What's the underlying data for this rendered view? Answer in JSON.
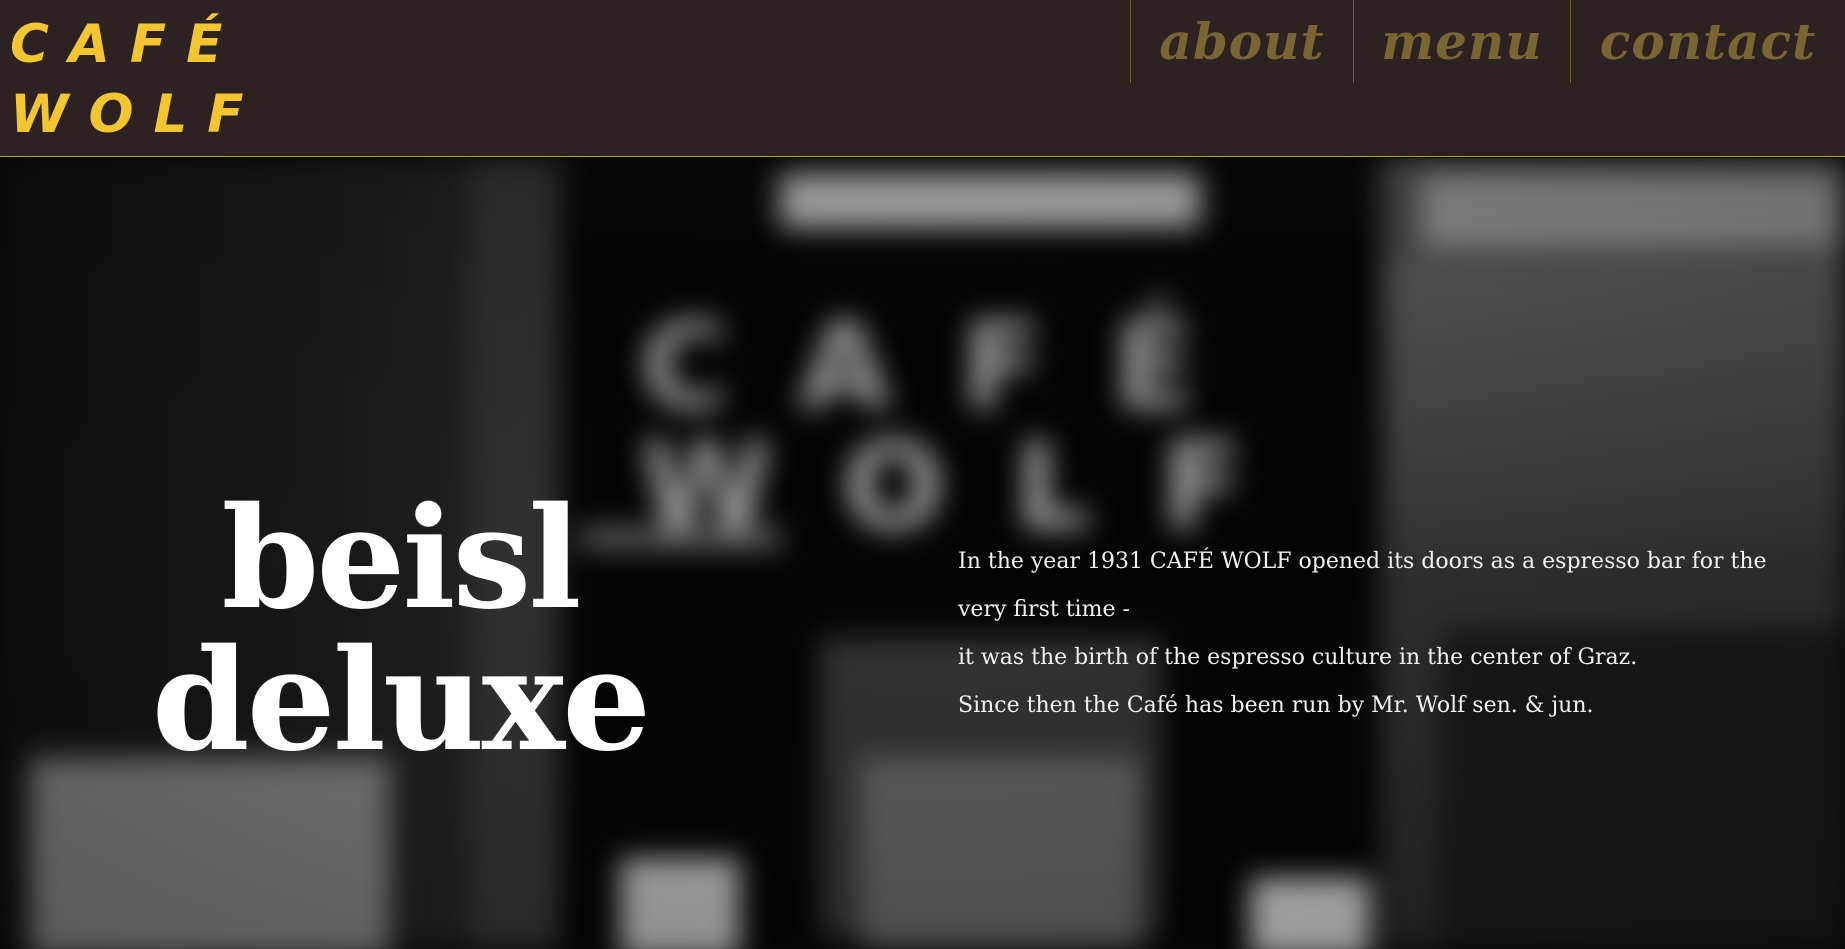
{
  "brand": {
    "logo_line1": "CAFÉ",
    "logo_line2": "WOLF",
    "accent_color": "#f3c531",
    "nav_color": "#7a6532",
    "header_bg": "#2b2221"
  },
  "nav": {
    "items": [
      {
        "label": "about"
      },
      {
        "label": "menu"
      },
      {
        "label": "contact"
      }
    ]
  },
  "hero": {
    "headline_line1": "beisl",
    "headline_line2": "deluxe",
    "background_image": "blurred black-and-white photo of the café storefront",
    "intro": [
      "In the year 1931 CAFÉ WOLF opened its doors as a espresso bar for the very first time -",
      "it was the birth of the espresso culture in the center of Graz.",
      "Since then the Café has been run by Mr. Wolf sen. & jun."
    ]
  }
}
